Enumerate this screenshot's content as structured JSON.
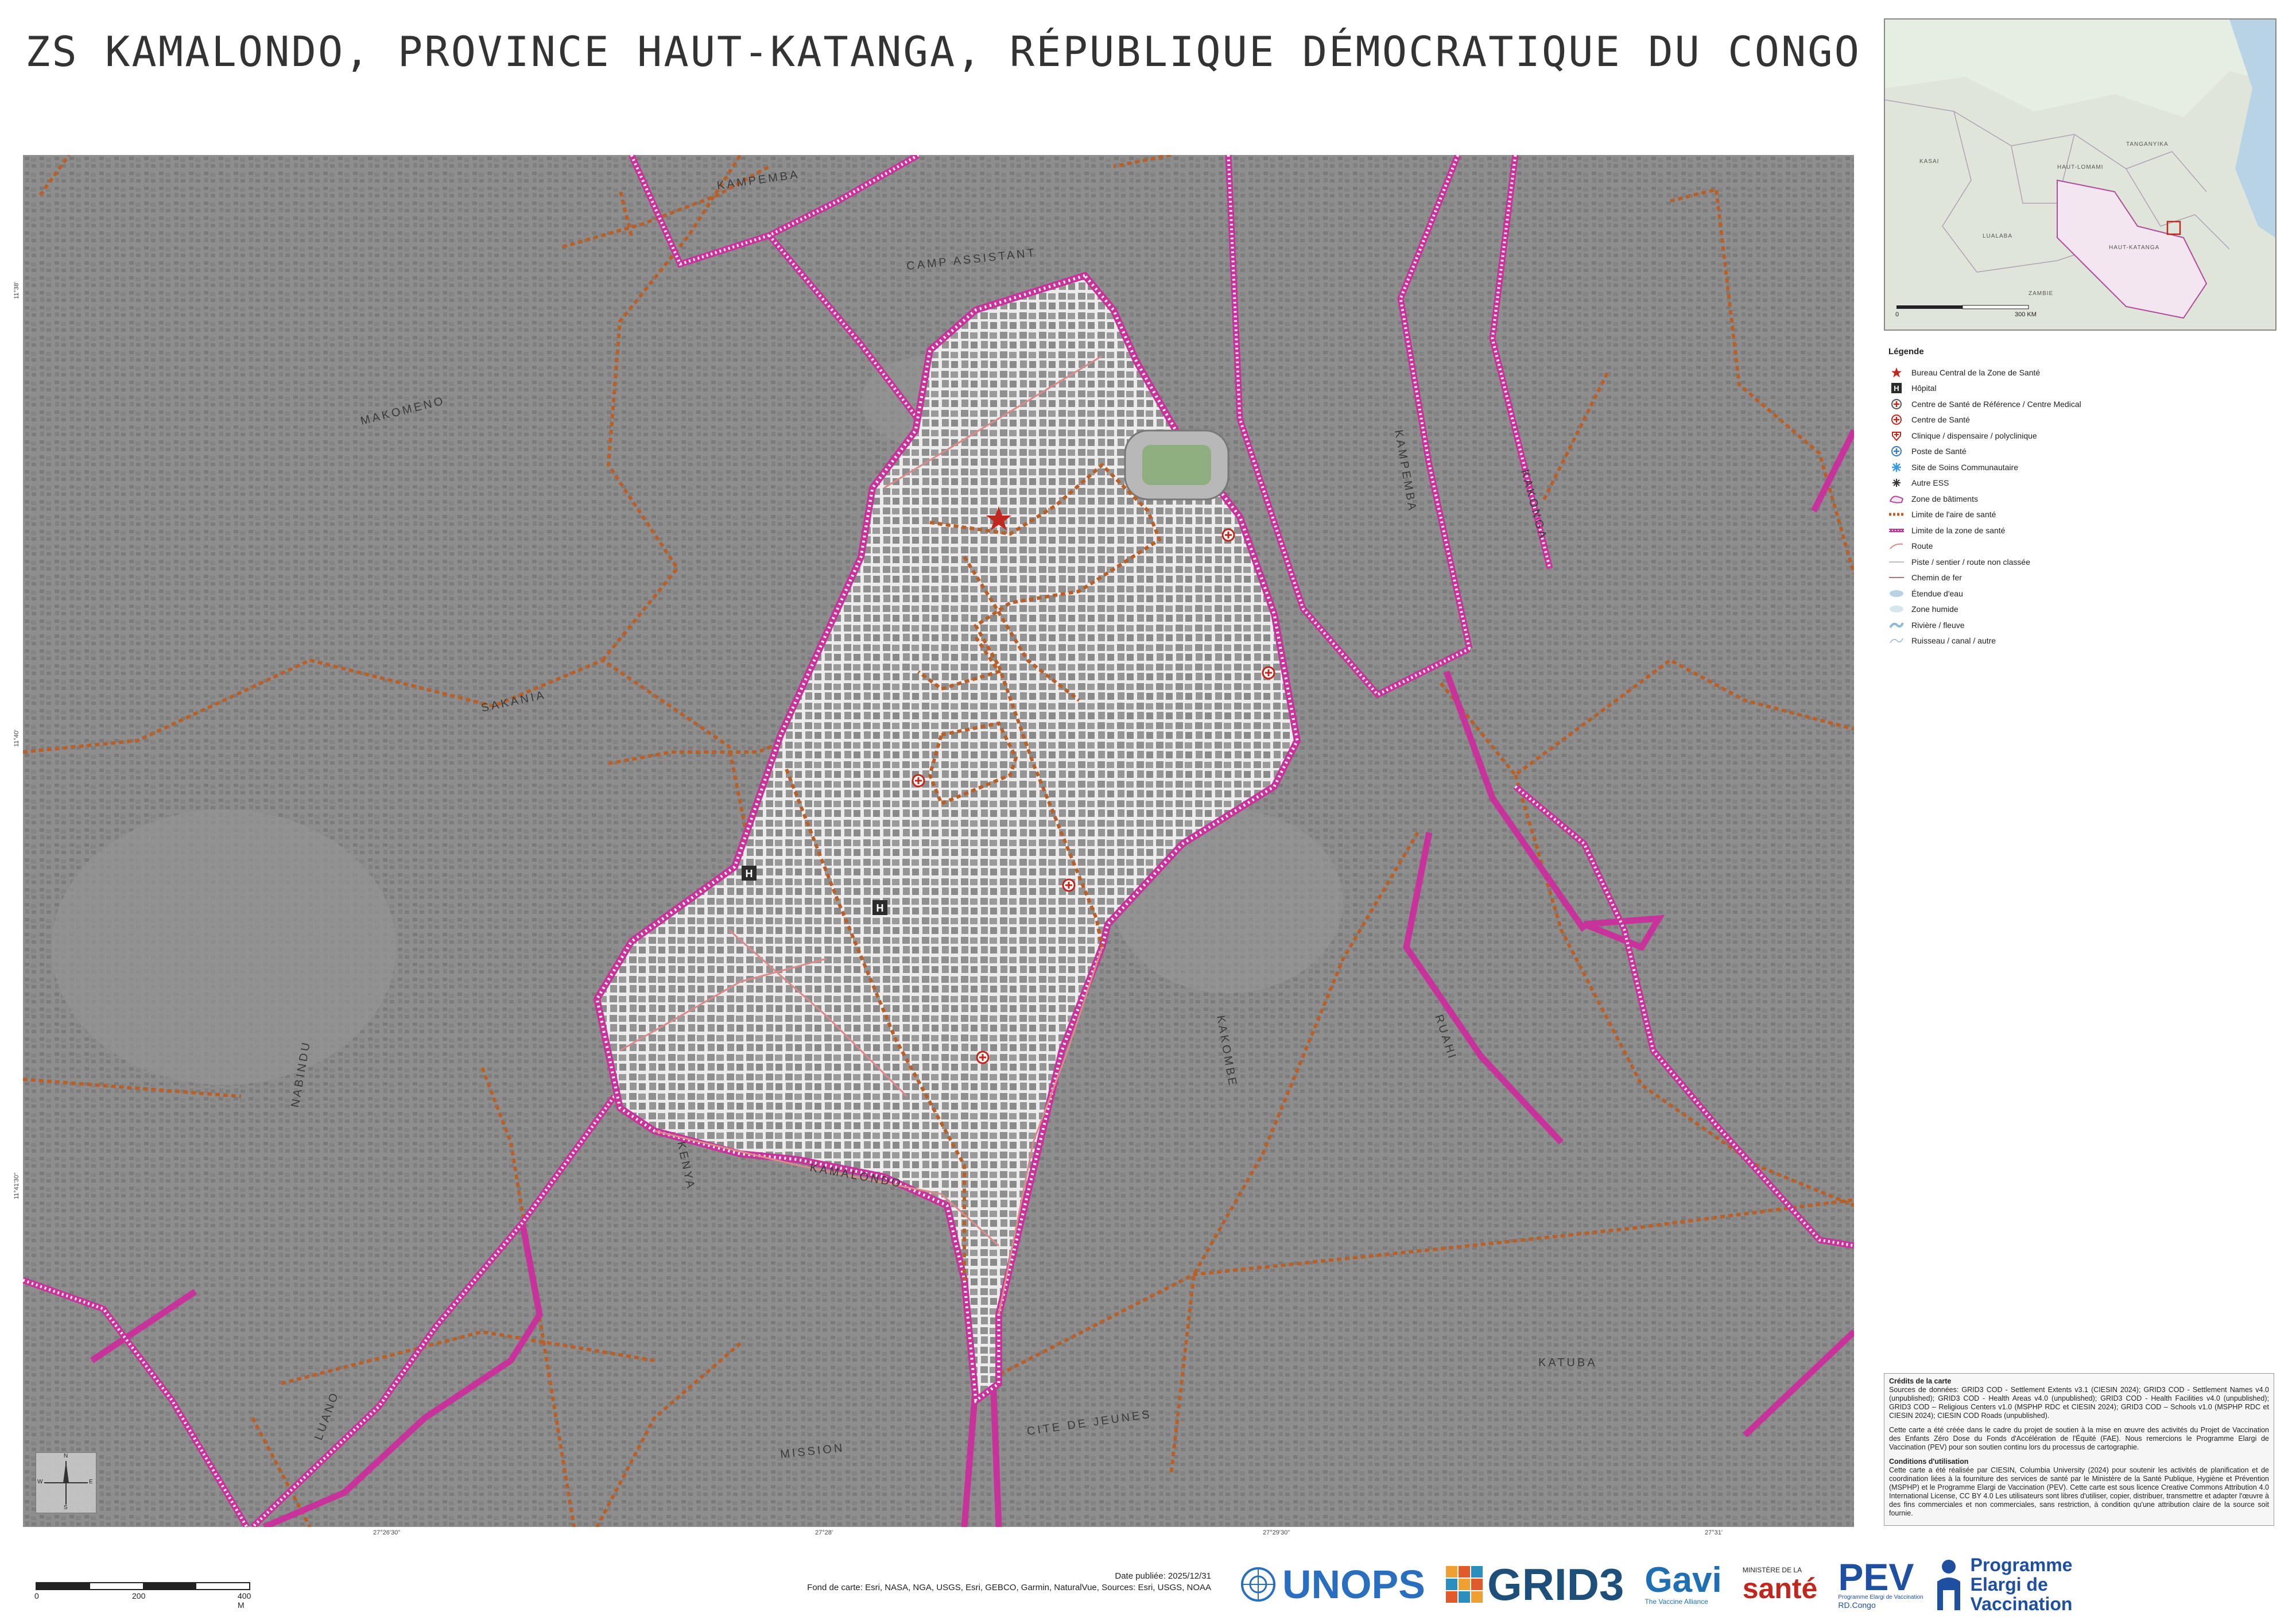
{
  "title": "ZS KAMALONDO, PROVINCE HAUT-KATANGA, RÉPUBLIQUE DÉMOCRATIQUE DU CONGO",
  "map": {
    "place_labels": [
      "KAMPEMBA",
      "CAMP ASSISTANT",
      "MAKOMENO",
      "SAKANIA",
      "KAMALONDO",
      "KAKOMBE",
      "KAMPEMBA",
      "KENYA",
      "RUAHI",
      "KAKONGA",
      "NABINDU",
      "CITE DE JEUNES",
      "KATUBA",
      "MISSION",
      "LUANO"
    ],
    "coord_labels": [
      "27°26'30\"",
      "27°28'",
      "27°29'30\"",
      "27°31'"
    ],
    "side_coords": [
      "11°38'",
      "11°40'",
      "11°41'30\""
    ],
    "north_arrow": {
      "n": "N",
      "s": "S",
      "e": "E",
      "w": "W"
    }
  },
  "inset": {
    "scale_zero": "0",
    "scale_max": "300 KM",
    "labels": [
      "TANGANYIKA",
      "HAUT-LOMAMI",
      "LUALABA",
      "HAUT-KATANGA",
      "KASAI",
      "ZAMBIE"
    ]
  },
  "legend": {
    "title": "Légende",
    "items": [
      {
        "icon": "red-star-icon",
        "label": "Bureau Central de la Zone de Santé"
      },
      {
        "icon": "hospital-h-icon",
        "label": "Hôpital"
      },
      {
        "icon": "reference-center-icon",
        "label": "Centre de Santé de Référence / Centre Medical"
      },
      {
        "icon": "health-center-icon",
        "label": "Centre de Santé"
      },
      {
        "icon": "clinic-icon",
        "label": "Clinique / dispensaire / polyclinique"
      },
      {
        "icon": "health-post-icon",
        "label": "Poste de Santé"
      },
      {
        "icon": "community-site-icon",
        "label": "Site de Soins Communautaire"
      },
      {
        "icon": "other-ess-icon",
        "label": "Autre ESS"
      },
      {
        "icon": "building-zone-icon",
        "label": "Zone de bâtiments"
      },
      {
        "icon": "health-area-boundary-icon",
        "label": "Limite de l'aire de santé"
      },
      {
        "icon": "health-zone-boundary-icon",
        "label": "Limite de la zone de santé"
      },
      {
        "icon": "road-icon",
        "label": "Route"
      },
      {
        "icon": "track-icon",
        "label": "Piste / sentier / route non classée"
      },
      {
        "icon": "railway-icon",
        "label": "Chemin de fer"
      },
      {
        "icon": "water-body-icon",
        "label": "Étendue d'eau"
      },
      {
        "icon": "wetland-icon",
        "label": "Zone humide"
      },
      {
        "icon": "river-icon",
        "label": "Rivière / fleuve"
      },
      {
        "icon": "stream-icon",
        "label": "Ruisseau / canal / autre"
      }
    ],
    "colors": {
      "boundary_zone": "#c8339b",
      "boundary_area": "#b8602a",
      "hospital": "#2b2b2b",
      "star": "#c0281f"
    }
  },
  "credits": {
    "heading": "Crédits de la carte",
    "sources": "Sources de données: GRID3 COD - Settlement Extents v3.1 (CIESIN 2024); GRID3 COD - Settlement Names v4.0 (unpublished); GRID3 COD - Health Areas v4.0 (unpublished); GRID3 COD - Health Facilities v4.0 (unpublished); GRID3 COD – Religious Centers v1.0 (MSPHP RDC et CIESIN 2024); GRID3 COD – Schools v1.0 (MSPHP RDC et CIESIN 2024); CIESIN COD Roads (unpublished).",
    "project": "Cette carte a été créée dans le cadre du projet de soutien à la mise en œuvre des activités du Projet de Vaccination des Enfants Zéro Dose du Fonds d'Accélération de l'Équité (FAE). Nous remercions le Programme Elargi de Vaccination (PEV) pour son soutien continu lors du processus de cartographie.",
    "conditions_heading": "Conditions d'utilisation",
    "conditions": "Cette carte a été réalisée par CIESIN, Columbia University (2024) pour soutenir les activités de planification et de coordination liées à la fourniture des services de santé par le Ministère de la Santé Publique, Hygiène et Prévention (MSPHP) et le Programme Elargi de Vaccination (PEV). Cette carte est sous licence Creative Commons Attribution 4.0 International License, CC BY 4.0 Les utilisateurs sont libres d'utiliser, copier, distribuer, transmettre et adapter l'œuvre à des fins commerciales et non commerciales, sans restriction, à condition qu'une attribution claire de la source soit fournie."
  },
  "scale": {
    "zero": "0",
    "mid": "200",
    "max": "400 M"
  },
  "date": "Date publiée: 2025/12/31",
  "basemap": "Fond de carte: Esri, NASA, NGA, USGS, Esri, GEBCO, Garmin, NaturalVue, Sources: Esri, USGS, NOAA",
  "logos": {
    "un": "UN",
    "unops": "UNOPS",
    "grid3": "GRID3",
    "gavi": "Gavi",
    "gavi_sub": "The Vaccine Alliance",
    "ministry_top": "MINISTÈRE DE LA",
    "ministry": "santé",
    "pev": "PEV",
    "pev_sub1": "Programme Elargi de Vaccination",
    "pev_sub2": "RD.Congo",
    "programme": [
      "Programme",
      "Elargi de",
      "Vaccination"
    ]
  }
}
